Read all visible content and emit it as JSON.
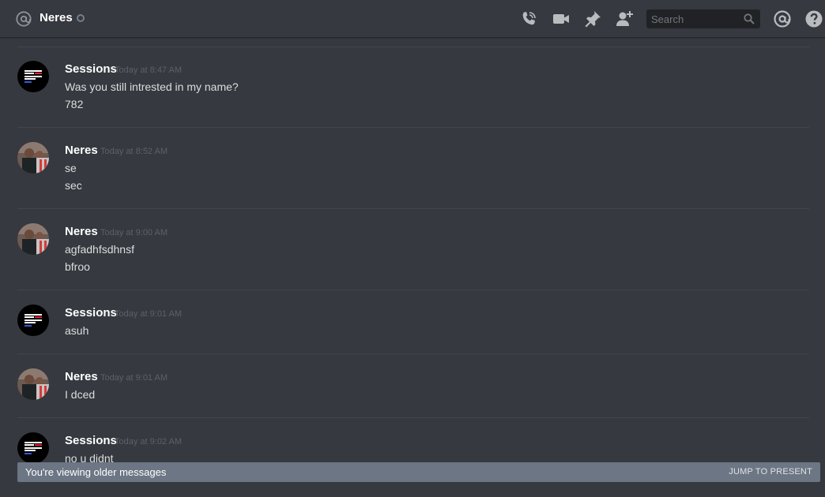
{
  "header": {
    "channel_name": "Neres",
    "search_placeholder": "Search"
  },
  "messages": [
    {
      "author": "Sessions",
      "timestamp": "Today at 8:47 AM",
      "avatar": "sessions-avatar",
      "lines": [
        "Was you still intrested in my name?",
        "782"
      ]
    },
    {
      "author": "Neres",
      "timestamp": "Today at 8:52 AM",
      "avatar": "neres-avatar",
      "lines": [
        "se",
        "sec"
      ]
    },
    {
      "author": "Neres",
      "timestamp": "Today at 9:00 AM",
      "avatar": "neres-avatar",
      "lines": [
        "agfadhfsdhnsf",
        "bfroo"
      ]
    },
    {
      "author": "Sessions",
      "timestamp": "Today at 9:01 AM",
      "avatar": "sessions-avatar",
      "lines": [
        "asuh"
      ]
    },
    {
      "author": "Neres",
      "timestamp": "Today at 9:01 AM",
      "avatar": "neres-avatar",
      "lines": [
        "I dced"
      ]
    },
    {
      "author": "Sessions",
      "timestamp": "Today at 9:02 AM",
      "avatar": "sessions-avatar",
      "lines": [
        "no u didnt"
      ]
    }
  ],
  "older_bar": {
    "text": "You're viewing older messages",
    "jump_label": "JUMP TO PRESENT"
  },
  "colors": {
    "background": "#36393f",
    "older_bar": "#6c7684",
    "username": "#ffffff",
    "timestamp": "#5d6167"
  }
}
